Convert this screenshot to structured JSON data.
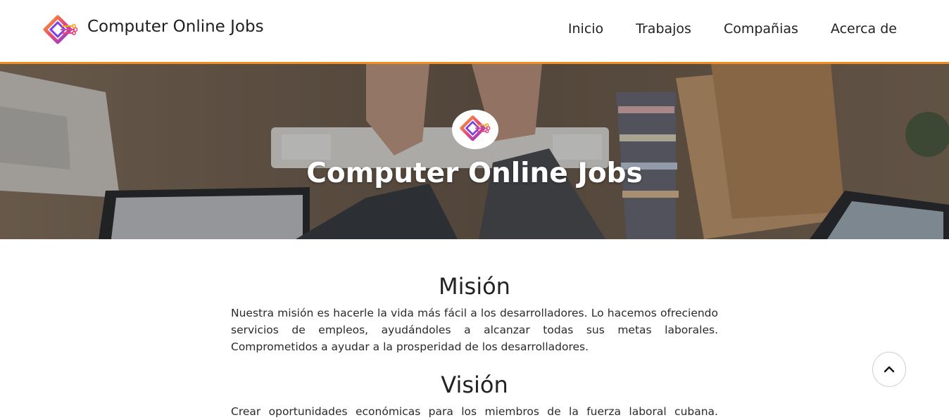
{
  "brand": {
    "name": "Computer Online Jobs",
    "logo_icon": "circuit-diamond-icon"
  },
  "nav": {
    "items": [
      {
        "label": "Inicio"
      },
      {
        "label": "Trabajos"
      },
      {
        "label": "Compañias"
      },
      {
        "label": "Acerca de"
      }
    ]
  },
  "hero": {
    "title": "Computer Online Jobs",
    "logo_icon": "circuit-diamond-icon"
  },
  "mission": {
    "heading": "Misión",
    "text": "Nuestra misión es hacerle la vida más fácil a los desarrolladores. Lo hacemos ofreciendo servicios de empleos, ayudándoles a alcanzar todas sus metas laborales. Comprometidos a ayudar a la prosperidad de los desarrolladores."
  },
  "vision": {
    "heading": "Visión",
    "text": "Crear oportunidades económicas para los miembros de la fuerza laboral cubana. Facilitar a"
  },
  "back_to_top": {
    "icon": "chevron-up-icon"
  },
  "colors": {
    "accent": "#f28c1e",
    "logo_purple": "#7b3fe4",
    "logo_orange": "#f5a623",
    "logo_pink": "#e8457a"
  }
}
